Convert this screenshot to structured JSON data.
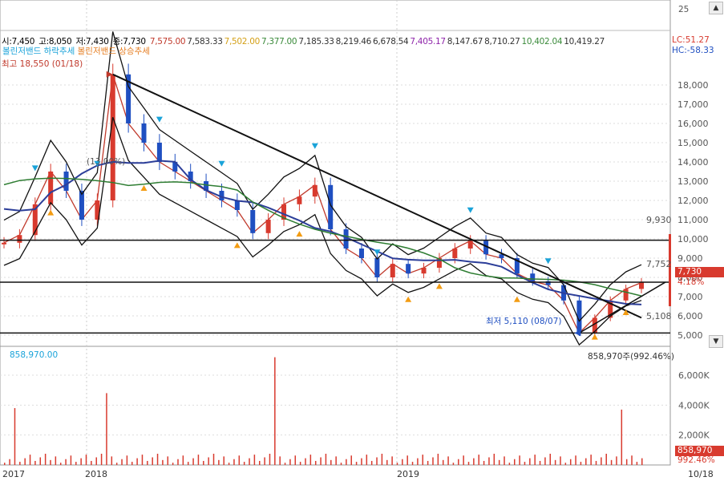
{
  "ohlc": {
    "open": "시:7,450",
    "high": "고:8,050",
    "low": "저:7,430",
    "close": "종:7,730",
    "ma_values": [
      {
        "text": "7,575.00",
        "color": "#c0392b"
      },
      {
        "text": "7,583.33",
        "color": "#333333"
      },
      {
        "text": "7,502.00",
        "color": "#d4a017"
      },
      {
        "text": "7,377.00",
        "color": "#3a8a3a"
      },
      {
        "text": "7,185.33",
        "color": "#333333"
      },
      {
        "text": "8,219.46",
        "color": "#333333"
      },
      {
        "text": "6,678.54",
        "color": "#333333"
      },
      {
        "text": "7,405.17",
        "color": "#8e24aa"
      },
      {
        "text": "8,147.67",
        "color": "#333333"
      },
      {
        "text": "8,710.27",
        "color": "#333333"
      },
      {
        "text": "10,402.04",
        "color": "#3a8a3a"
      },
      {
        "text": "10,419.27",
        "color": "#333333"
      }
    ]
  },
  "signals": {
    "down_label": "볼린저밴드 하락추세",
    "up_label": "볼린저밴드 상승추세",
    "down_color": "#1aa3d9",
    "up_color": "#f39c12"
  },
  "annotations": {
    "high_label": "최고 18,550 (01/18)",
    "low_label": "최저 5,110 (08/07)",
    "pct_label": "(13.00%)",
    "level_9930": "9,930",
    "level_7752": "7,752",
    "level_5108": "5,108"
  },
  "indicators": {
    "lc": "LC:51.27",
    "hc": "HC:-58.33",
    "top_tick": "25"
  },
  "price_box": {
    "value": "7,730",
    "pct": "4.18%"
  },
  "volume": {
    "left_label": "858,970.00",
    "right_label": "858,970주(992.46%)",
    "box_value": "858,970",
    "box_pct": "992.46%"
  },
  "price_axis": [
    "18,000",
    "17,000",
    "16,000",
    "15,000",
    "14,000",
    "13,000",
    "12,000",
    "11,000",
    "10,000",
    "9,000",
    "8,000",
    "7,000",
    "6,000",
    "5,000"
  ],
  "volume_axis": [
    "6,000K",
    "4,000K",
    "2,000K"
  ],
  "x_axis": [
    "2017",
    "2018",
    "2019",
    "10/18"
  ],
  "colors": {
    "up": "#d83a2e",
    "down": "#1f4fc1",
    "grid": "#dddddd"
  },
  "chart_data": {
    "type": "line",
    "title": "",
    "x": [
      "2017",
      "2018",
      "2019"
    ],
    "close_series_approx": [
      9800,
      10200,
      11800,
      13500,
      12500,
      11000,
      12000,
      18550,
      16000,
      15000,
      14000,
      13500,
      13000,
      12500,
      12000,
      11500,
      10300,
      11000,
      11800,
      12200,
      12800,
      10500,
      9500,
      9000,
      8000,
      8700,
      8200,
      8500,
      9000,
      9500,
      9900,
      9200,
      9000,
      8200,
      7800,
      7600,
      6800,
      5110,
      5900,
      6800,
      7400,
      7730
    ],
    "ylim": [
      4500,
      19500
    ],
    "volume_ylim": [
      0,
      7500000
    ],
    "annotations": {
      "high": {
        "value": 18550,
        "date": "01/18"
      },
      "low": {
        "value": 5110,
        "date": "08/07"
      },
      "horizontal_levels": [
        9930,
        7752,
        5108
      ]
    },
    "last_close": 7730,
    "last_volume": 858970
  }
}
